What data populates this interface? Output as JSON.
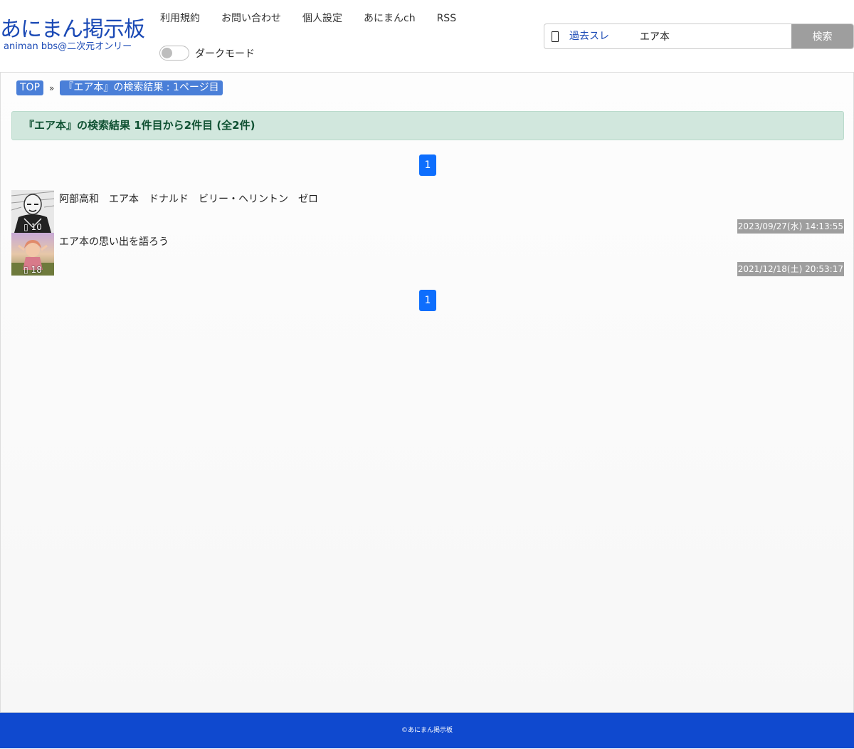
{
  "site": {
    "title": "あにまん掲示板",
    "subtitle": "animan bbs@二次元オンリー"
  },
  "nav": {
    "items": [
      "利用規約",
      "お問い合わせ",
      "個人設定",
      "あにまんch",
      "RSS"
    ]
  },
  "dark_mode": {
    "label": "ダークモード",
    "enabled": false
  },
  "search": {
    "scope": "過去スレ",
    "value": "エア本",
    "button": "検索"
  },
  "breadcrumb": {
    "top": "TOP",
    "separator": "»",
    "current": "『エア本』の検索結果 : 1ページ目"
  },
  "result_summary": "『エア本』の検索結果 1件目から2件目 (全2件)",
  "pagination": {
    "current": "1"
  },
  "threads": [
    {
      "title": "阿部高和　エア本　ドナルド　ビリー・ヘリントン　ゼロ",
      "count": "10",
      "date": "2023/09/27(水) 14:13:55"
    },
    {
      "title": "エア本の思い出を語ろう",
      "count": "18",
      "date": "2021/12/18(土) 20:53:17"
    }
  ],
  "footer": "©あにまん掲示板",
  "colors": {
    "brand": "#1a49b5",
    "footer": "#0f49cf",
    "pager": "#0d6efd",
    "result_bg": "#d1e7dd",
    "result_text": "#0f5132"
  }
}
